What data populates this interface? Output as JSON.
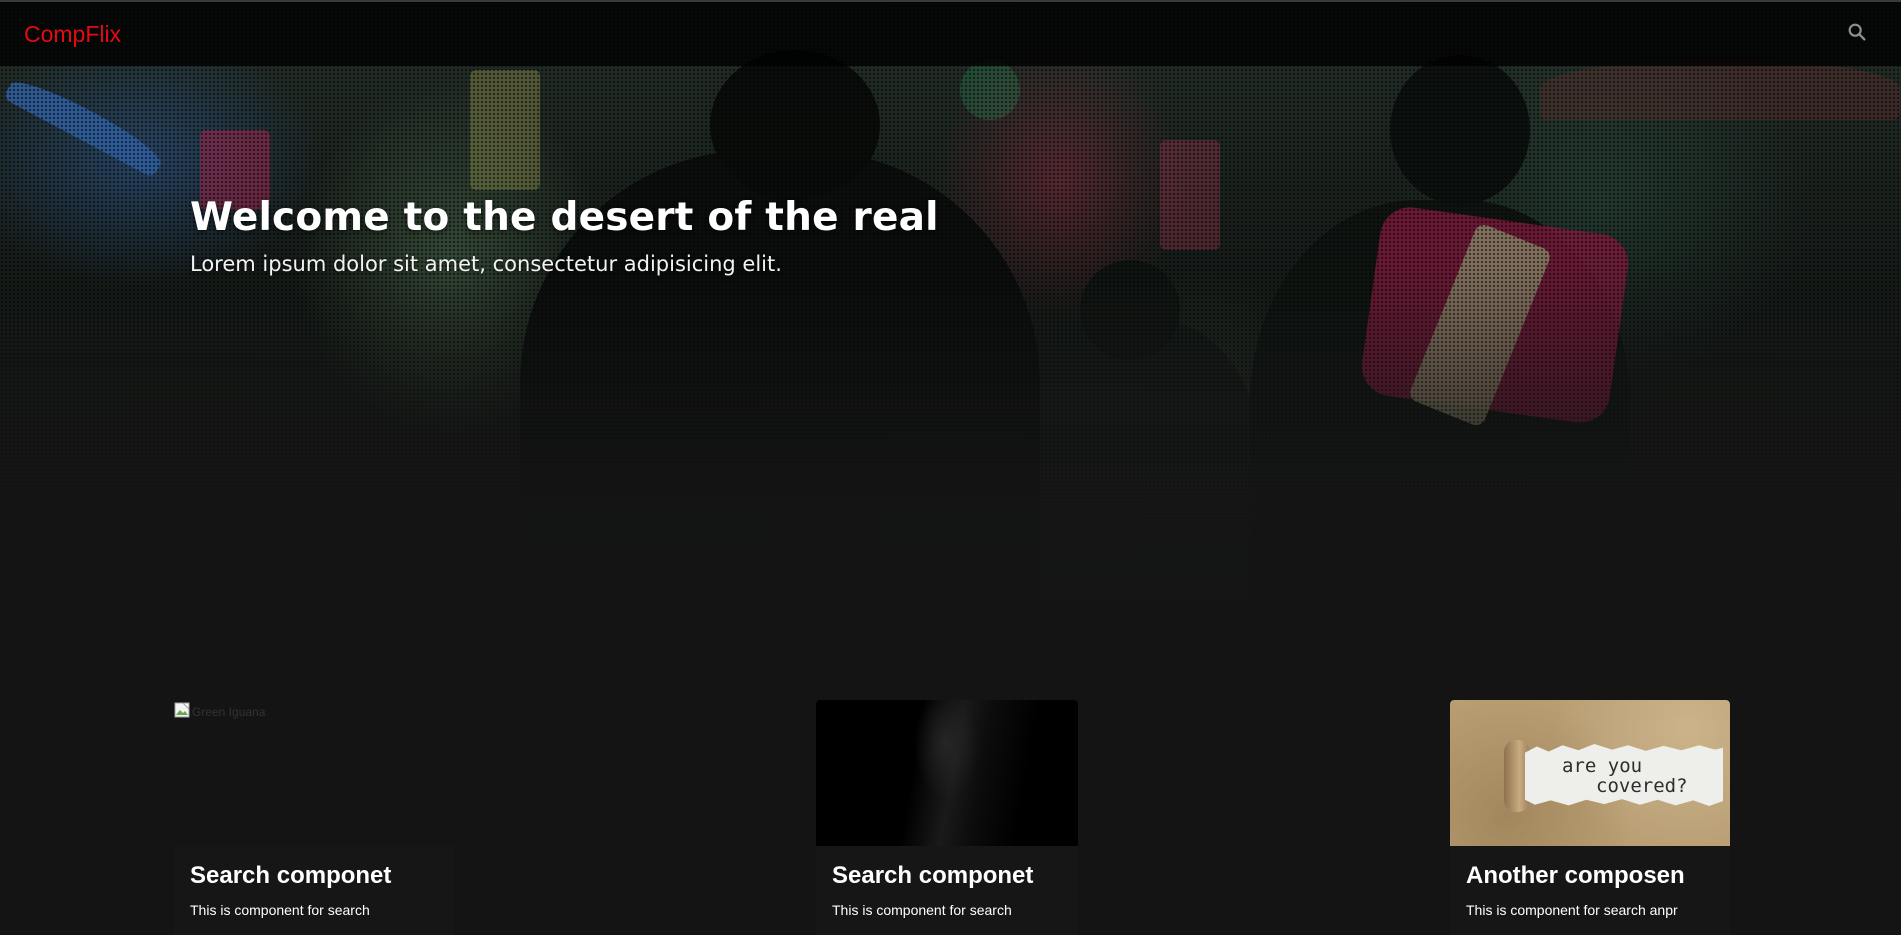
{
  "navbar": {
    "brand": "CompFlix",
    "search_icon": "search-icon",
    "brand_color": "#e50914"
  },
  "hero": {
    "title": "Welcome to the desert of the real",
    "subtitle": "Lorem ipsum dolor sit amet, consectetur adipisicing elit."
  },
  "cards": [
    {
      "image_alt": "Green Iguana",
      "title": "Search componet",
      "text": "This is component for search"
    },
    {
      "image_alt": "",
      "title": "Search componet",
      "text": "This is component for search"
    },
    {
      "image_alt": "",
      "image_text_line1": "are you",
      "image_text_line2": "covered?",
      "title": "Another composen",
      "text": "This is component for search anpr"
    }
  ],
  "colors": {
    "background": "#141414",
    "navbar": "#000000",
    "accent": "#e50914",
    "text": "#ffffff"
  }
}
